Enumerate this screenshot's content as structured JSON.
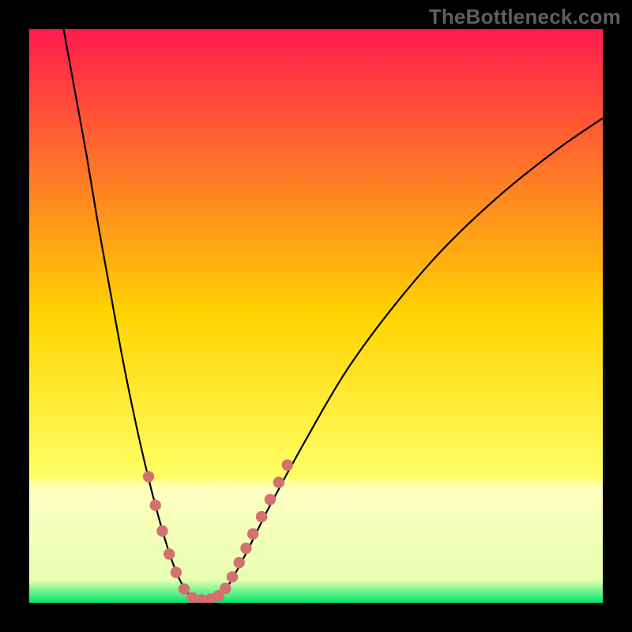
{
  "watermark": "TheBottleneck.com",
  "chart_data": {
    "type": "line",
    "title": "",
    "xlabel": "",
    "ylabel": "",
    "xlim": [
      0,
      100
    ],
    "ylim": [
      0,
      100
    ],
    "background_gradient_stops": [
      {
        "offset": 0.0,
        "color": "#ff1b4e"
      },
      {
        "offset": 0.5,
        "color": "#ffd400"
      },
      {
        "offset": 0.78,
        "color": "#ffff66"
      },
      {
        "offset": 0.8,
        "color": "#ffffc0"
      },
      {
        "offset": 0.96,
        "color": "#e6ffb0"
      },
      {
        "offset": 1.0,
        "color": "#00e66a"
      }
    ],
    "series": [
      {
        "name": "bottleneck-curve",
        "type": "line",
        "data": [
          {
            "x": 6.0,
            "y": 100.0
          },
          {
            "x": 8.0,
            "y": 89.0
          },
          {
            "x": 10.0,
            "y": 78.0
          },
          {
            "x": 12.0,
            "y": 66.0
          },
          {
            "x": 14.0,
            "y": 55.0
          },
          {
            "x": 16.0,
            "y": 44.0
          },
          {
            "x": 18.0,
            "y": 34.0
          },
          {
            "x": 20.0,
            "y": 25.0
          },
          {
            "x": 22.0,
            "y": 17.0
          },
          {
            "x": 24.0,
            "y": 10.0
          },
          {
            "x": 26.0,
            "y": 4.5
          },
          {
            "x": 28.0,
            "y": 1.2
          },
          {
            "x": 29.0,
            "y": 0.5
          },
          {
            "x": 31.0,
            "y": 0.4
          },
          {
            "x": 33.0,
            "y": 1.0
          },
          {
            "x": 35.0,
            "y": 3.5
          },
          {
            "x": 38.0,
            "y": 9.0
          },
          {
            "x": 42.0,
            "y": 17.0
          },
          {
            "x": 48.0,
            "y": 28.0
          },
          {
            "x": 55.0,
            "y": 40.0
          },
          {
            "x": 63.0,
            "y": 51.0
          },
          {
            "x": 72.0,
            "y": 61.5
          },
          {
            "x": 82.0,
            "y": 71.0
          },
          {
            "x": 92.0,
            "y": 79.0
          },
          {
            "x": 100.0,
            "y": 84.5
          }
        ]
      },
      {
        "name": "highlight-points",
        "type": "scatter",
        "color": "#d37070",
        "data": [
          {
            "x": 20.8,
            "y": 22.0
          },
          {
            "x": 22.0,
            "y": 17.0
          },
          {
            "x": 23.2,
            "y": 12.5
          },
          {
            "x": 24.4,
            "y": 8.5
          },
          {
            "x": 25.6,
            "y": 5.3
          },
          {
            "x": 27.0,
            "y": 2.4
          },
          {
            "x": 28.4,
            "y": 0.9
          },
          {
            "x": 30.0,
            "y": 0.5
          },
          {
            "x": 31.6,
            "y": 0.6
          },
          {
            "x": 33.0,
            "y": 1.2
          },
          {
            "x": 34.2,
            "y": 2.5
          },
          {
            "x": 35.4,
            "y": 4.5
          },
          {
            "x": 36.6,
            "y": 7.0
          },
          {
            "x": 37.8,
            "y": 9.5
          },
          {
            "x": 39.0,
            "y": 12.0
          },
          {
            "x": 40.5,
            "y": 15.0
          },
          {
            "x": 42.0,
            "y": 18.0
          },
          {
            "x": 43.5,
            "y": 21.0
          },
          {
            "x": 45.0,
            "y": 24.0
          }
        ]
      }
    ]
  }
}
